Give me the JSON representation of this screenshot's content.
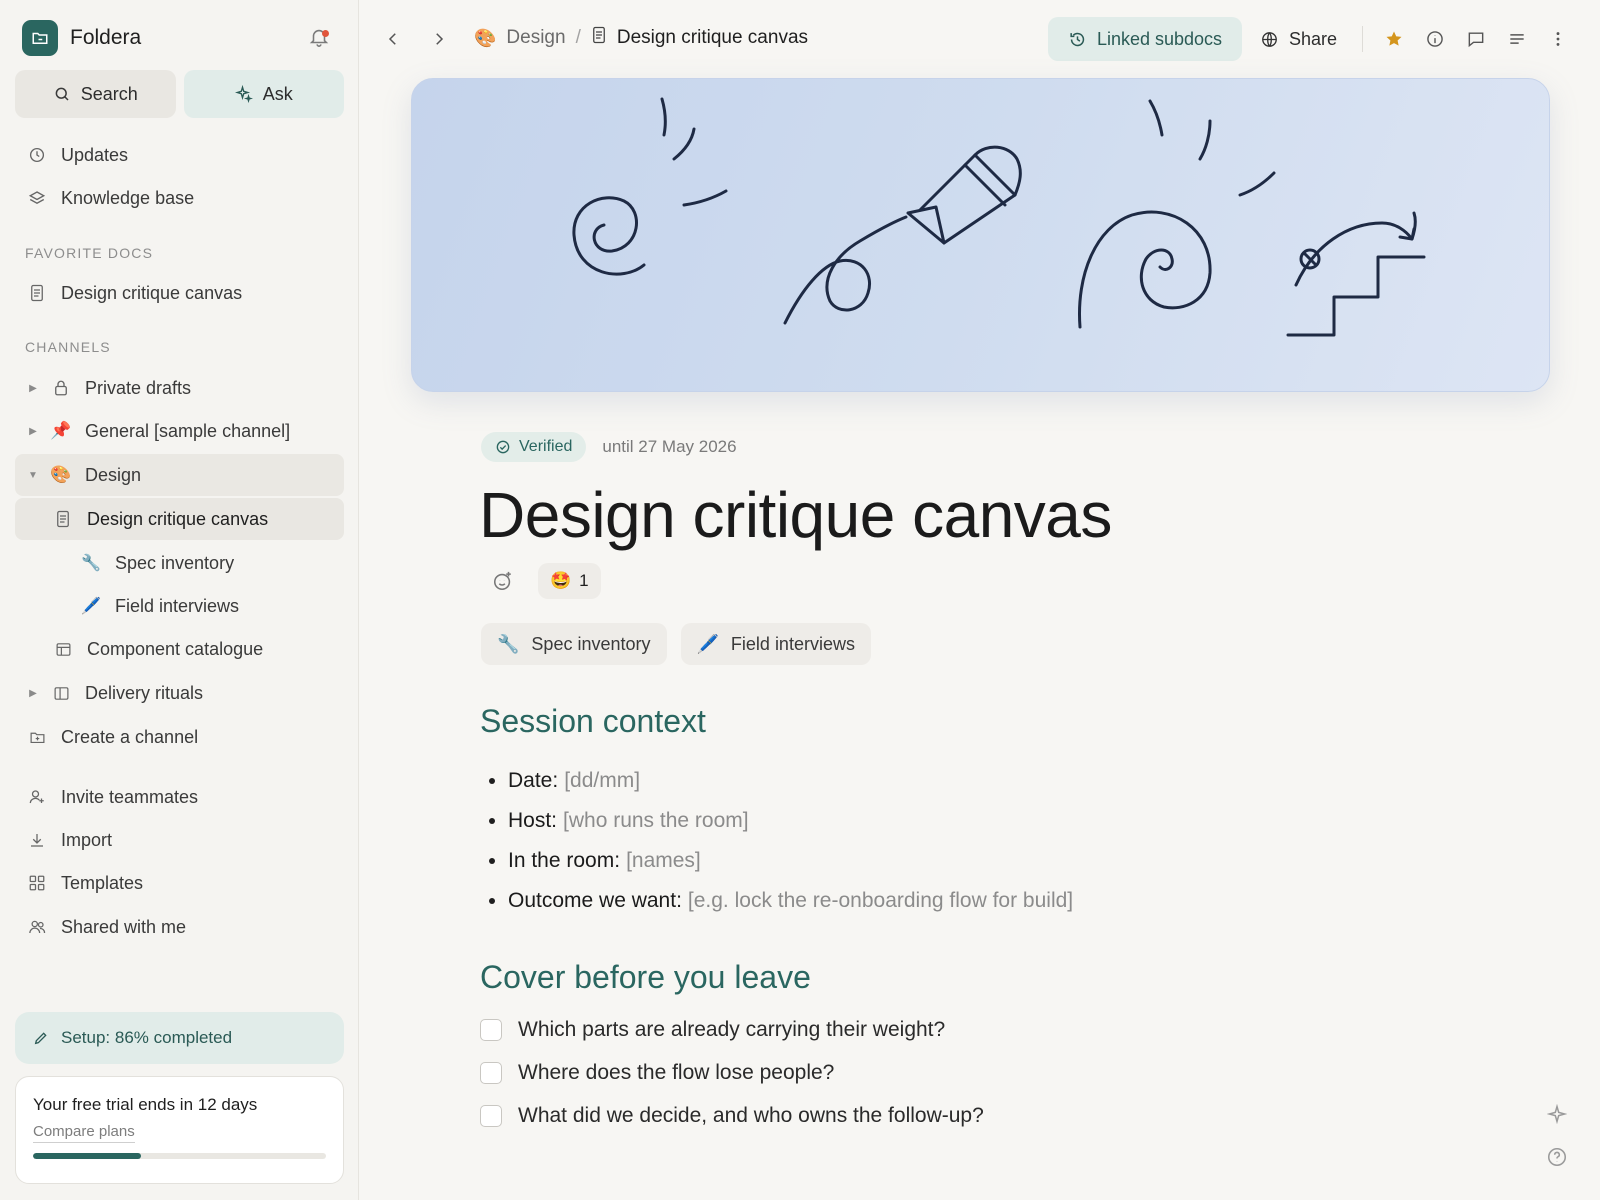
{
  "workspace": {
    "name": "Foldera"
  },
  "sidebar": {
    "search_label": "Search",
    "ask_label": "Ask",
    "updates": "Updates",
    "knowledge_base": "Knowledge base",
    "favorites_label": "FAVORITE DOCS",
    "favorite_doc": "Design critique canvas",
    "channels_label": "CHANNELS",
    "channels": [
      {
        "label": "Private drafts",
        "icon": "lock-icon"
      },
      {
        "label": "General [sample channel]",
        "icon": "pin-emoji",
        "emoji": "📌"
      },
      {
        "label": "Design",
        "icon": "palette-emoji",
        "emoji": "🎨"
      }
    ],
    "design_children": [
      {
        "label": "Design critique canvas",
        "icon": "document-icon"
      },
      {
        "label": "Spec inventory",
        "icon": "wrench-emoji",
        "emoji": "🔧"
      },
      {
        "label": "Field interviews",
        "icon": "pen-emoji",
        "emoji": "🖊️"
      },
      {
        "label": "Component catalogue",
        "icon": "table-icon"
      }
    ],
    "delivery_rituals": "Delivery rituals",
    "create_channel": "Create a channel",
    "invite": "Invite teammates",
    "import": "Import",
    "templates": "Templates",
    "shared": "Shared with me",
    "setup": "Setup: 86% completed",
    "trial_title": "Your free trial ends in 12 days",
    "trial_link": "Compare plans",
    "trial_progress": 0.37
  },
  "topbar": {
    "crumb_channel": "Design",
    "crumb_sep": "/",
    "crumb_doc": "Design critique canvas",
    "linked_subdocs": "Linked subdocs",
    "share": "Share"
  },
  "doc": {
    "verified": "Verified",
    "verified_until": "until 27 May 2026",
    "title": "Design critique canvas",
    "reaction_emoji": "🤩",
    "reaction_count": "1",
    "subdocs": [
      {
        "label": "Spec inventory",
        "emoji": "🔧"
      },
      {
        "label": "Field interviews",
        "emoji": "🖊️"
      }
    ],
    "section1_title": "Session context",
    "bullets": [
      {
        "key": "Date:",
        "placeholder": "[dd/mm]"
      },
      {
        "key": "Host:",
        "placeholder": "[who runs the room]"
      },
      {
        "key": "In the room:",
        "placeholder": "[names]"
      },
      {
        "key": "Outcome we want:",
        "placeholder": "[e.g. lock the re-onboarding flow for build]"
      }
    ],
    "section2_title": "Cover before you leave",
    "checklist": [
      "Which parts are already carrying their weight?",
      "Where does the flow lose people?",
      "What did we decide, and who owns the follow-up?"
    ]
  },
  "colors": {
    "accent": "#2a6660",
    "accent_bg": "#e1ece9",
    "star": "#d4951c"
  }
}
